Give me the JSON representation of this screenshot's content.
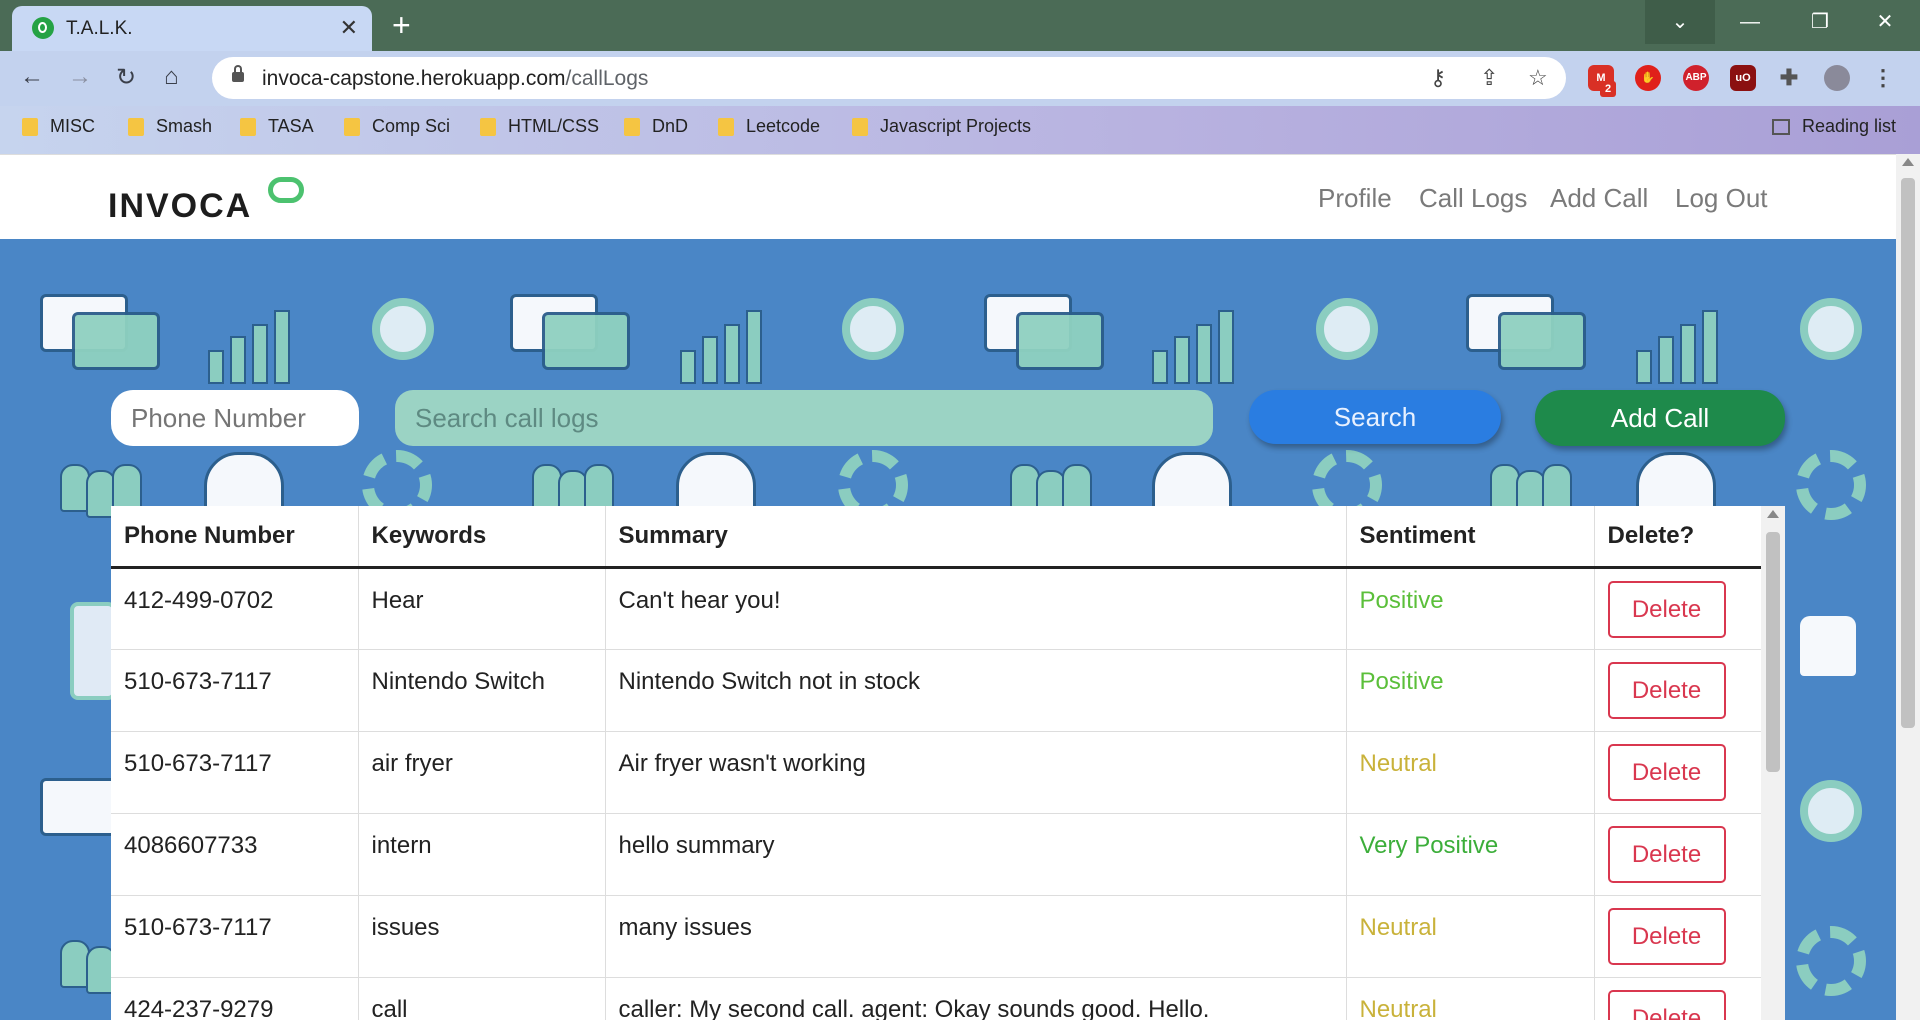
{
  "browser": {
    "tab_title": "T.A.L.K.",
    "url_domain": "invoca-capstone.herokuapp.com",
    "url_path": "/callLogs",
    "extension_badge": "2",
    "extension_abp": "ABP",
    "extension_ublock": "uO",
    "bookmarks": [
      "MISC",
      "Smash",
      "TASA",
      "Comp Sci",
      "HTML/CSS",
      "DnD",
      "Leetcode",
      "Javascript Projects"
    ],
    "reading_list": "Reading list"
  },
  "site": {
    "logo": "INVOCA",
    "nav": [
      "Profile",
      "Call Logs",
      "Add Call",
      "Log Out"
    ]
  },
  "controls": {
    "phone_placeholder": "Phone Number",
    "search_placeholder": "Search call logs",
    "search_label": "Search",
    "add_call_label": "Add Call"
  },
  "table": {
    "headers": [
      "Phone Number",
      "Keywords",
      "Summary",
      "Sentiment",
      "Delete?"
    ],
    "delete_label": "Delete",
    "rows": [
      {
        "phone": "412-499-0702",
        "keywords": "Hear",
        "summary": "Can't hear you!",
        "sentiment": "Positive",
        "sentiment_color": "#5bbf3a"
      },
      {
        "phone": "510-673-7117",
        "keywords": "Nintendo Switch",
        "summary": "Nintendo Switch not in stock",
        "sentiment": "Positive",
        "sentiment_color": "#5bbf3a"
      },
      {
        "phone": "510-673-7117",
        "keywords": "air fryer",
        "summary": "Air fryer wasn't working",
        "sentiment": "Neutral",
        "sentiment_color": "#c9b23a"
      },
      {
        "phone": "4086607733",
        "keywords": "intern",
        "summary": "hello summary",
        "sentiment": "Very Positive",
        "sentiment_color": "#3cae3a"
      },
      {
        "phone": "510-673-7117",
        "keywords": "issues",
        "summary": "many issues",
        "sentiment": "Neutral",
        "sentiment_color": "#c9b23a"
      },
      {
        "phone": "424-237-9279",
        "keywords": "call",
        "summary": "caller: My second call. agent: Okay sounds good. Hello.",
        "sentiment": "Neutral",
        "sentiment_color": "#c9b23a"
      }
    ]
  }
}
